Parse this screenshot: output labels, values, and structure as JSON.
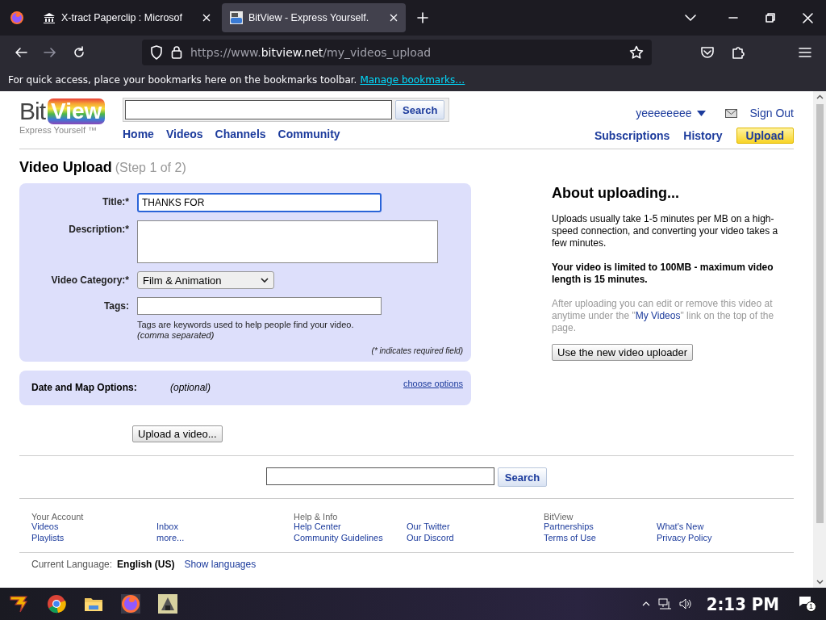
{
  "browser": {
    "tabs": [
      {
        "title": "X-tract Paperclip : Microsof",
        "selected": false
      },
      {
        "title": "BitView - Express Yourself.",
        "selected": true
      }
    ],
    "url": {
      "scheme": "https://www.",
      "domain": "bitview.net",
      "path": "/my_videos_upload"
    },
    "bookmarks_bar": {
      "message": "For quick access, place your bookmarks here on the bookmarks toolbar.",
      "link": "Manage bookmarks…"
    }
  },
  "header": {
    "logo": {
      "word_1": "Bit",
      "word_2": "View",
      "tagline": "Express Yourself ™"
    },
    "search_button": "Search",
    "nav": [
      "Home",
      "Videos",
      "Channels",
      "Community"
    ],
    "user": "yeeeeeeee",
    "sign_out": "Sign Out",
    "right_nav": [
      {
        "label": "Subscriptions",
        "kind": "link"
      },
      {
        "label": "History",
        "kind": "link"
      },
      {
        "label": "Upload",
        "kind": "highlight"
      }
    ]
  },
  "heading": {
    "title": "Video Upload",
    "step": "(Step 1 of 2)"
  },
  "form": {
    "fields": [
      {
        "label": "Title:*",
        "kind": "text",
        "value": "THANKS FOR ",
        "focused": true
      },
      {
        "label": "Description:*",
        "kind": "textarea",
        "focused": false
      },
      {
        "label": "Video Category:*",
        "kind": "select",
        "value": "Film & Animation",
        "focused": false
      },
      {
        "label": "Tags:",
        "kind": "tags",
        "focused": false
      }
    ],
    "tags_hint": "Tags are keywords used to help people find your video.",
    "tags_note": "(comma separated)",
    "required_note": "(* indicates required field)"
  },
  "date_options": {
    "label": "Date and Map Options:",
    "note": "(optional)",
    "link": "choose options"
  },
  "upload_button": "Upload a video...",
  "about": {
    "title": "About uploading...",
    "paragraph_1": "Uploads usually take 1-5 minutes per MB on a high-speed connection, and converting your video takes a few minutes.",
    "paragraph_2": "Your video is limited to 100MB - maximum video length is 15 minutes.",
    "paragraph_3": {
      "before": "After uploading you can edit or remove this video at anytime under the \"",
      "link": "My Videos",
      "after": "\" link on the top of the page."
    },
    "button": "Use the new video uploader"
  },
  "footer": {
    "search_button": "Search",
    "groups": [
      {
        "heading": "Your Account",
        "links": [
          "Videos",
          "Inbox",
          "Playlists",
          "more..."
        ]
      },
      {
        "heading": "Help & Info",
        "links": [
          "Help Center",
          "Our Twitter",
          "Community Guidelines",
          "Our Discord"
        ]
      },
      {
        "heading": "BitView",
        "links": [
          "Partnerships",
          "What's New",
          "Terms of Use",
          "Privacy Policy"
        ]
      }
    ],
    "language_label": "Current Language:",
    "language": "English (US)",
    "language_link": "Show languages"
  },
  "taskbar": {
    "clock": "2:13 PM",
    "notifications": "1"
  }
}
